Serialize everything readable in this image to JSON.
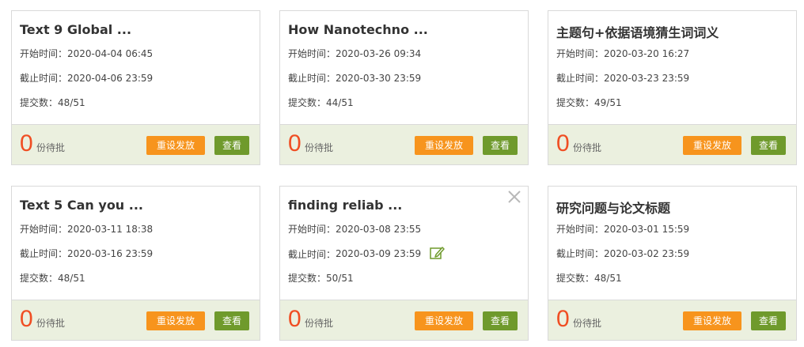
{
  "labels": {
    "start_prefix": "开始时间：",
    "end_prefix": "截止时间：",
    "submit_prefix": "提交数：",
    "pending_suffix": "份待批",
    "reissue_button": "重设发放",
    "view_button": "查看"
  },
  "colors": {
    "pending_number": "#f04e23",
    "reissue_button": "#f7941d",
    "view_button": "#6f9a2c",
    "footer_bg": "#ebf0df"
  },
  "icons": {
    "close": "close-icon",
    "edit": "edit-icon"
  },
  "cards": [
    {
      "title": "Text 9 Global ...",
      "start": "2020-04-04 06:45",
      "end": "2020-04-06 23:59",
      "submitted": "48/51",
      "pending": "0"
    },
    {
      "title": "How Nanotechno ...",
      "start": "2020-03-26 09:34",
      "end": "2020-03-30 23:59",
      "submitted": "44/51",
      "pending": "0"
    },
    {
      "title": "主题句+依据语境猜生词词义",
      "start": "2020-03-20 16:27",
      "end": "2020-03-23 23:59",
      "submitted": "49/51",
      "pending": "0"
    },
    {
      "title": "Text 5 Can you ...",
      "start": "2020-03-11 18:38",
      "end": "2020-03-16 23:59",
      "submitted": "48/51",
      "pending": "0"
    },
    {
      "title": "finding reliab ...",
      "start": "2020-03-08 23:55",
      "end": "2020-03-09 23:59",
      "submitted": "50/51",
      "pending": "0"
    },
    {
      "title": "研究问题与论文标题",
      "start": "2020-03-01 15:59",
      "end": "2020-03-02 23:59",
      "submitted": "48/51",
      "pending": "0"
    }
  ]
}
